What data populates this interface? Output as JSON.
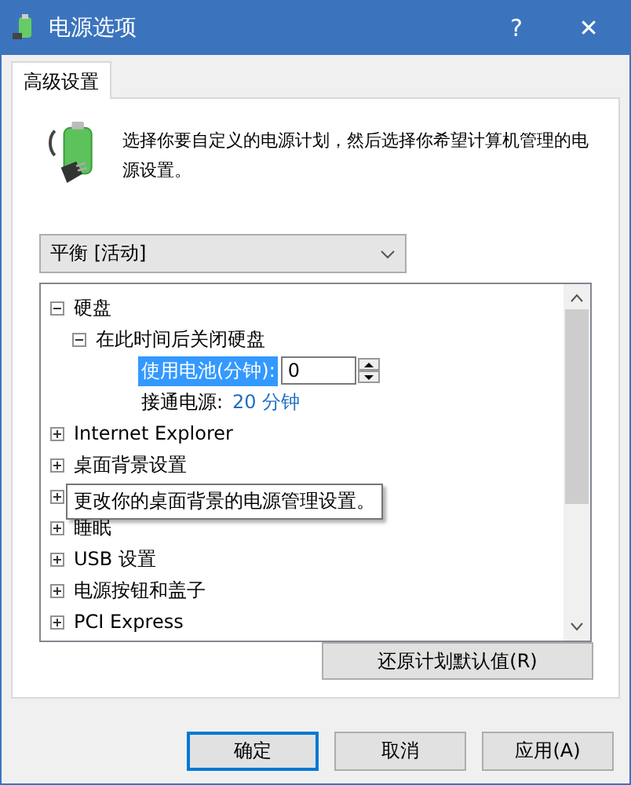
{
  "window": {
    "title": "电源选项",
    "help": "?",
    "close": "✕"
  },
  "tabs": [
    {
      "label": "高级设置",
      "selected": true
    }
  ],
  "description": "选择你要自定义的电源计划，然后选择你希望计算机管理的电源设置。",
  "plan_select": {
    "value": "平衡 [活动]"
  },
  "tree": [
    {
      "label": "硬盘",
      "expanded": true,
      "children": [
        {
          "label": "在此时间后关闭硬盘",
          "expanded": true,
          "settings": [
            {
              "kind": "spin",
              "label": "使用电池(分钟):",
              "value": "0",
              "selected": true
            },
            {
              "kind": "value",
              "label": "接通电源:",
              "value": "20 分钟",
              "selected": false
            }
          ]
        }
      ]
    },
    {
      "label": "Internet Explorer",
      "expanded": false
    },
    {
      "label": "桌面背景设置",
      "expanded": false
    },
    {
      "kind": "covered",
      "expanded": false,
      "tooltip": "更改你的桌面背景的电源管理设置。"
    },
    {
      "label": "睡眠",
      "expanded": false
    },
    {
      "label": "USB 设置",
      "expanded": false
    },
    {
      "label": "电源按钮和盖子",
      "expanded": false
    },
    {
      "label": "PCI Express",
      "expanded": false
    }
  ],
  "restore_button": "还原计划默认值(R)",
  "buttons": [
    {
      "label": "确定",
      "default": true
    },
    {
      "label": "取消",
      "default": false
    },
    {
      "label": "应用(A)",
      "default": false
    }
  ]
}
